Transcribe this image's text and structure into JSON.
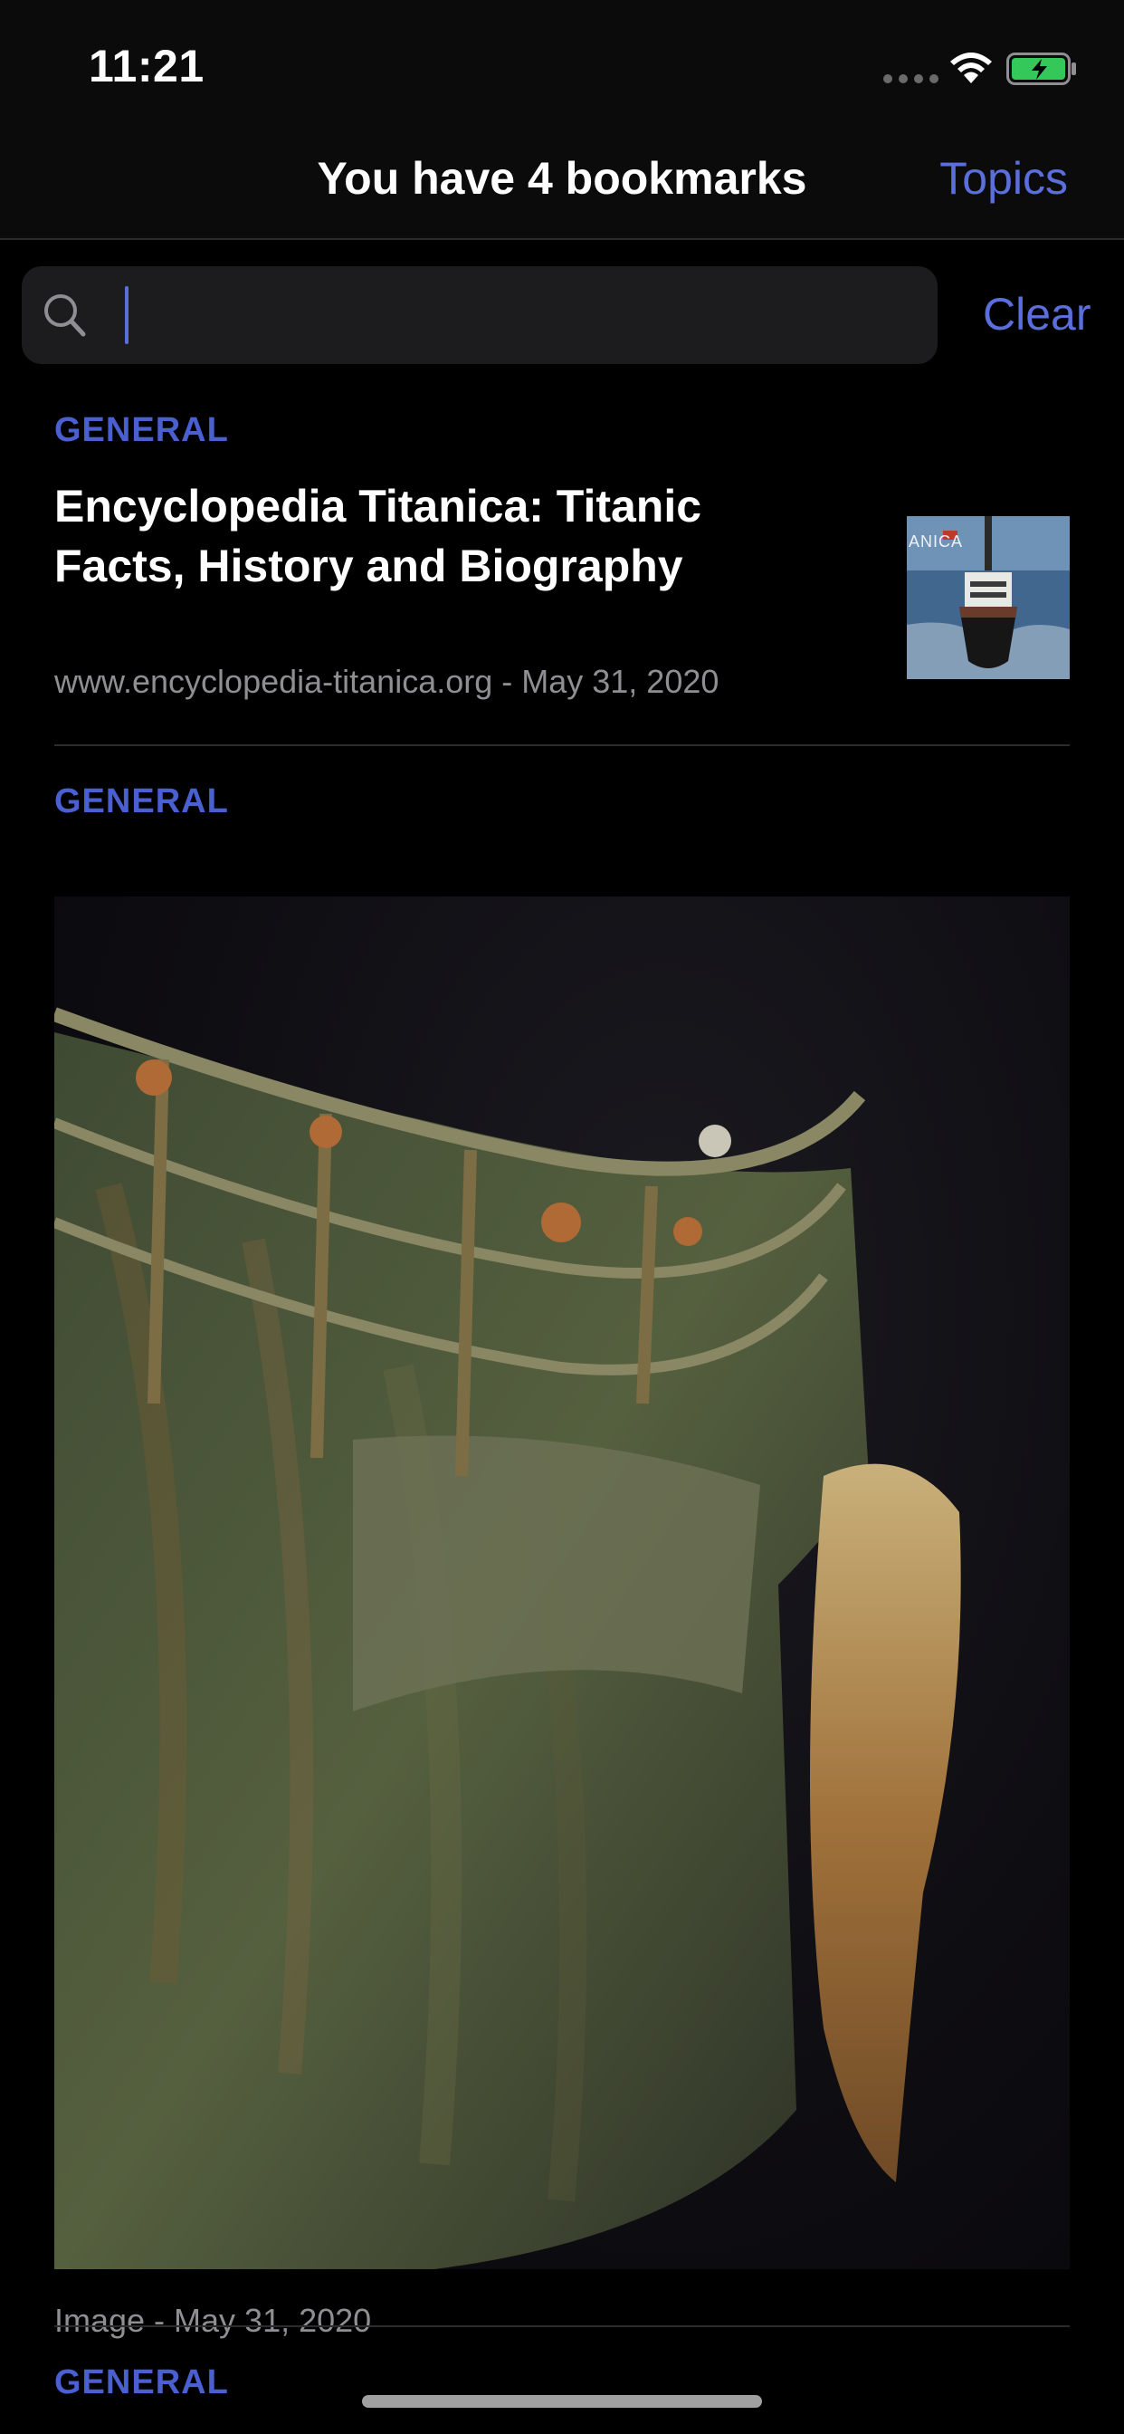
{
  "status_bar": {
    "time": "11:21",
    "icons": [
      "signal-dots-icon",
      "wifi-icon",
      "battery-charging-icon"
    ],
    "battery_color": "#34c759"
  },
  "nav": {
    "title": "You have 4 bookmarks",
    "topics_label": "Topics"
  },
  "search": {
    "value": "",
    "placeholder": "",
    "clear_label": "Clear"
  },
  "colors": {
    "accent": "#5b6fdc",
    "category": "#4a5fd0",
    "secondary_text": "#8e8e93",
    "background": "#000000"
  },
  "bookmarks": [
    {
      "category": "GENERAL",
      "title": "Encyclopedia Titanica: Titanic Facts, History and Biography",
      "meta": "www.encyclopedia-titanica.org - May 31, 2020",
      "thumbnail_text": "ANICA"
    },
    {
      "category": "GENERAL",
      "meta": "Image - May 31, 2020"
    },
    {
      "category": "GENERAL"
    }
  ]
}
